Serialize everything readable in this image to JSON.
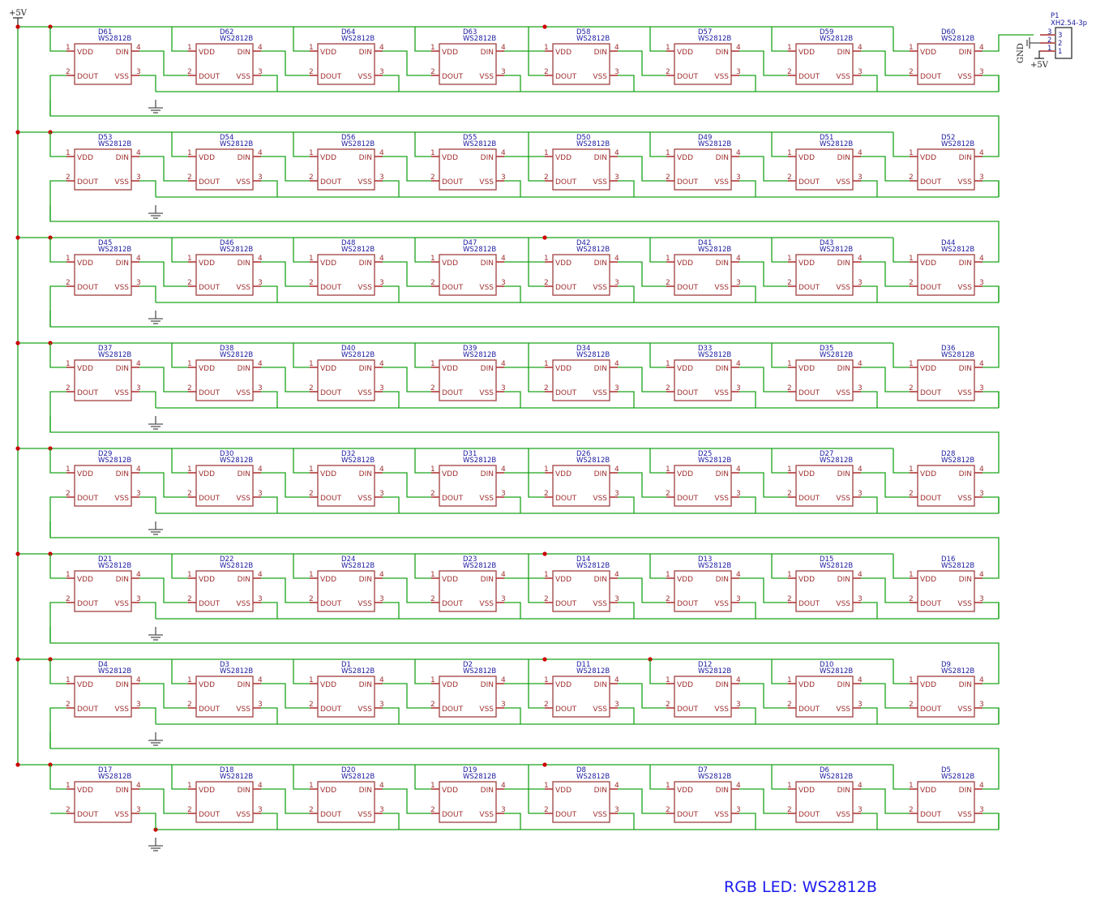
{
  "title": "RGB LED: WS2812B",
  "power_label": "+5V",
  "gnd_label": "GND",
  "part_value": "WS2812B",
  "pins": {
    "vdd": "VDD",
    "din": "DIN",
    "dout": "DOUT",
    "vss": "VSS",
    "vdd_num": "1",
    "dout_num": "2",
    "vss_num": "3",
    "din_num": "4"
  },
  "connector": {
    "ref": "P1",
    "value": "XH2.54-3p",
    "pins": [
      "3",
      "2",
      "1"
    ]
  },
  "rows": [
    [
      "D61",
      "D62",
      "D64",
      "D63",
      "D58",
      "D57",
      "D59",
      "D60"
    ],
    [
      "D53",
      "D54",
      "D56",
      "D55",
      "D50",
      "D49",
      "D51",
      "D52"
    ],
    [
      "D45",
      "D46",
      "D48",
      "D47",
      "D42",
      "D41",
      "D43",
      "D44"
    ],
    [
      "D37",
      "D38",
      "D40",
      "D39",
      "D34",
      "D33",
      "D35",
      "D36"
    ],
    [
      "D29",
      "D30",
      "D32",
      "D31",
      "D26",
      "D25",
      "D27",
      "D28"
    ],
    [
      "D21",
      "D22",
      "D24",
      "D23",
      "D14",
      "D13",
      "D15",
      "D16"
    ],
    [
      "D4",
      "D3",
      "D1",
      "D2",
      "D11",
      "D12",
      "D10",
      "D9"
    ],
    [
      "D17",
      "D18",
      "D20",
      "D19",
      "D8",
      "D7",
      "D6",
      "D5"
    ]
  ],
  "colors": {
    "wire": "#1ba31b",
    "part": "#a04040",
    "ref": "#1a1aa0",
    "junction": "#cc0000"
  }
}
